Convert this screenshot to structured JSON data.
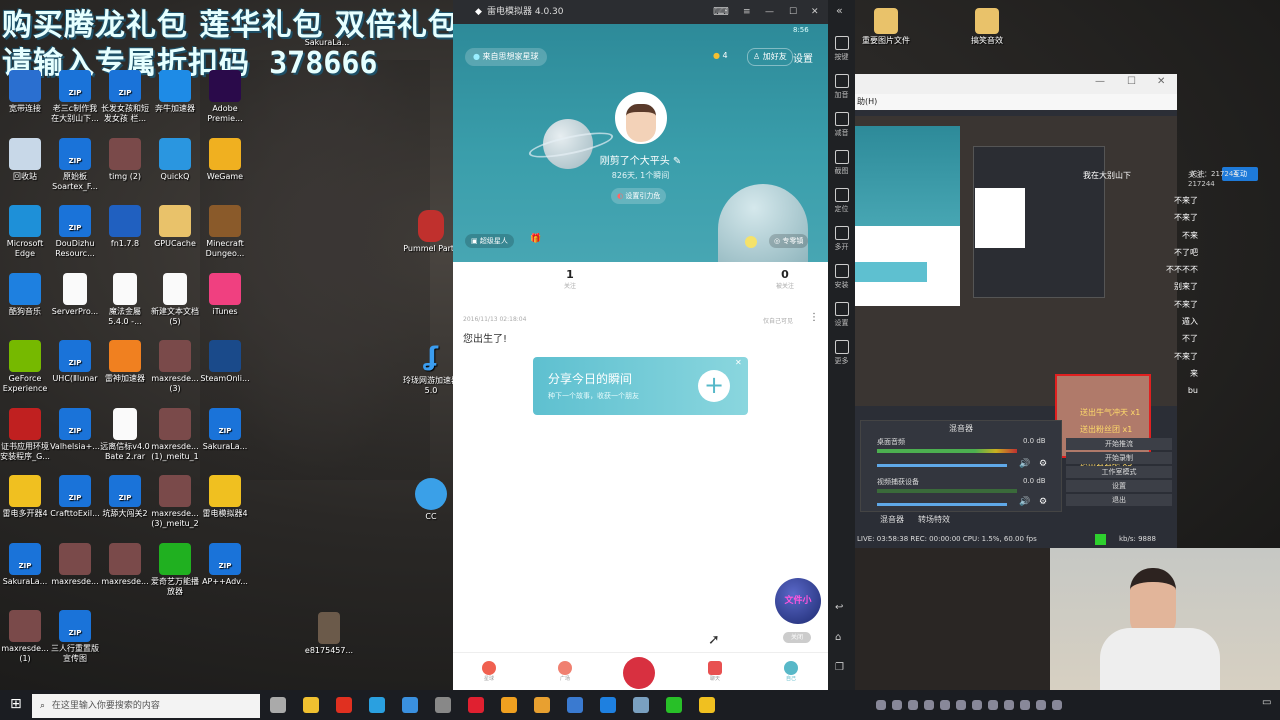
{
  "overlay": {
    "line1": "购买腾龙礼包  莲华礼包  双倍礼包",
    "line2": "请输入专属折扣码",
    "code": "378666"
  },
  "desktop_icons": [
    {
      "label": "宽带连接",
      "kind": "net"
    },
    {
      "label": "老三c制作我在大别山下...",
      "kind": "zip"
    },
    {
      "label": "长发女孩和短发女孩 栏...",
      "kind": "zip"
    },
    {
      "label": "奔牛加速器",
      "kind": "app"
    },
    {
      "label": "Adobe Premie...",
      "kind": "pr"
    },
    {
      "label": "回收站",
      "kind": "bin"
    },
    {
      "label": "原始板 Soartex_F...",
      "kind": "zip"
    },
    {
      "label": "timg (2)",
      "kind": "img"
    },
    {
      "label": "QuickQ",
      "kind": "qq"
    },
    {
      "label": "WeGame",
      "kind": "wg"
    },
    {
      "label": "Microsoft Edge",
      "kind": "edge"
    },
    {
      "label": "DouDizhu Resourc...",
      "kind": "zip"
    },
    {
      "label": "fn1.7.8",
      "kind": "fn"
    },
    {
      "label": "GPUCache",
      "kind": "folder"
    },
    {
      "label": "Minecraft Dungeo...",
      "kind": "mc"
    },
    {
      "label": "酷狗音乐",
      "kind": "kg"
    },
    {
      "label": "ServerPro...",
      "kind": "doc"
    },
    {
      "label": "魔法金屬 5.4.0 -...",
      "kind": "doc"
    },
    {
      "label": "新建文本文档 (5)",
      "kind": "doc"
    },
    {
      "label": "iTunes",
      "kind": "itunes"
    },
    {
      "label": "GeForce Experience",
      "kind": "nv"
    },
    {
      "label": "UHC(Ⅱlunar",
      "kind": "zip"
    },
    {
      "label": "雷神加速器",
      "kind": "ls"
    },
    {
      "label": "maxresde... (3)",
      "kind": "img"
    },
    {
      "label": "SteamOnli...",
      "kind": "steam"
    },
    {
      "label": "证书应用环境安装程序_G...",
      "kind": "cert"
    },
    {
      "label": "Valhelsia+...",
      "kind": "zip"
    },
    {
      "label": "远离信标v4.0 Bate 2.rar",
      "kind": "doc"
    },
    {
      "label": "maxresde... (1)_meitu_1",
      "kind": "img"
    },
    {
      "label": "SakuraLa...",
      "kind": "zip"
    },
    {
      "label": "雷电多开器4",
      "kind": "ld"
    },
    {
      "label": "CrafttoExil...",
      "kind": "zip"
    },
    {
      "label": "坑舔大闯关2",
      "kind": "zip"
    },
    {
      "label": "maxresde... (3)_meitu_2",
      "kind": "img"
    },
    {
      "label": "雷电模拟器4",
      "kind": "ld2"
    },
    {
      "label": "SakuraLa...",
      "kind": "zip"
    },
    {
      "label": "maxresde...",
      "kind": "img"
    },
    {
      "label": "maxresde...",
      "kind": "img"
    },
    {
      "label": "爱奇艺万能播放器",
      "kind": "iq"
    },
    {
      "label": "AP++Adv...",
      "kind": "zip"
    },
    {
      "label": "maxresde... (1)",
      "kind": "img"
    },
    {
      "label": "三人行重置版宣传图",
      "kind": "zip"
    }
  ],
  "top_desktop_icons": [
    {
      "label": "此电脑"
    },
    {
      "label": "老三c制作我在大别山下"
    },
    {
      "label": "maxresde..."
    },
    {
      "label": "系统启动加速"
    },
    {
      "label": "鲁普达罗"
    }
  ],
  "right_desktop": {
    "sakura": "SakuraLa...",
    "folder1": "重要图片文件",
    "folder2": "搞笑音效",
    "pummel": "Pummel Party",
    "network": "玲珑网游加速器5.0",
    "cc": "CC",
    "e817": "e8175457..."
  },
  "emulator": {
    "title": "雷电模拟器 4.0.30",
    "time": "8:56",
    "source_pill": "来自思想家星球",
    "coins": "4",
    "add_friend": "加好友",
    "settings": "设置",
    "username": "刚剪了个大平头",
    "stats": "826天, 1个瞬间",
    "gravity_btn": "设置引力危",
    "super_star": "超级星人",
    "expert": "专零镇",
    "following_count": "1",
    "following_label": "关注",
    "followers_count": "0",
    "followers_label": "被关注",
    "post_date": "2016/11/13 02:18:04",
    "post_visibility": "仅自己可见",
    "post_text": "您出生了!",
    "share_title": "分享今日的瞬间",
    "share_sub": "种下一个故事，收获一个朋友",
    "float_badge": "文件小",
    "float_close": "关闭",
    "nav": [
      "星球",
      "广场",
      "",
      "聊天",
      "自己"
    ]
  },
  "emu_sidebar": [
    "按键",
    "加音",
    "减音",
    "截图",
    "定位",
    "多开",
    "安装",
    "设置",
    "更多"
  ],
  "obs": {
    "menu": "助(H)",
    "stream_user": "我在大别山下",
    "follow_label": "关注：217244",
    "interact": "互动",
    "chat": [
      "不来了",
      "不来了",
      "不来",
      "不了吧",
      "不不不不",
      "别来了",
      "不来了",
      "遁入",
      "不了",
      "不来了",
      "来",
      "bu"
    ],
    "gifts": [
      "送出牛气冲天 x1",
      "送出粉丝团 x1",
      "送出钻石 x1",
      "送出么么哒 x5"
    ],
    "mixer_title": "混音器",
    "mixer_ch1": "桌面音频",
    "mixer_ch2": "视频捕获设备",
    "db1": "0.0 dB",
    "db2": "0.0 dB",
    "tab1": "混音器",
    "tab2": "转场特效",
    "controls": [
      "开始推流",
      "开始录制",
      "工作室模式",
      "设置",
      "退出"
    ],
    "status": "LIVE: 03:58:38   REC: 00:00:00   CPU: 1.5%, 60.00 fps",
    "kbs": "kb/s: 9888"
  },
  "taskbar": {
    "search_placeholder": "在这里输入你要搜索的内容"
  }
}
